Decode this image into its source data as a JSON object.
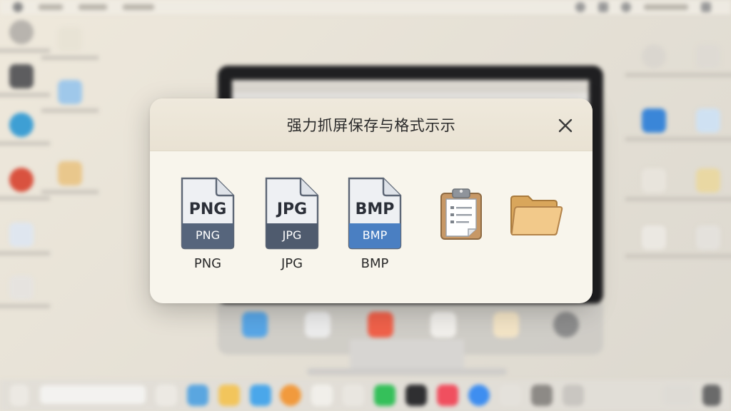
{
  "dialog": {
    "title": "强力抓屏保存与格式示示",
    "close_icon": "close-icon"
  },
  "formats": [
    {
      "name": "PNG",
      "band_label": "PNG",
      "caption": "PNG",
      "band_color": "#56657c"
    },
    {
      "name": "JPG",
      "band_label": "JPG",
      "caption": "JPG",
      "band_color": "#4f5b6e"
    },
    {
      "name": "BMP",
      "band_label": "BMP",
      "caption": "BMP",
      "band_color": "#4a7fc2"
    }
  ],
  "actions": [
    {
      "name": "clipboard",
      "icon": "clipboard-icon"
    },
    {
      "name": "folder",
      "icon": "folder-icon"
    }
  ],
  "colors": {
    "dialog_bg": "#f8f5ec",
    "header_bg": "#ece6d8",
    "file_body": "#eef0f3",
    "file_outline": "#5d6675",
    "clipboard_board": "#c79866",
    "folder": "#e9b96e"
  }
}
